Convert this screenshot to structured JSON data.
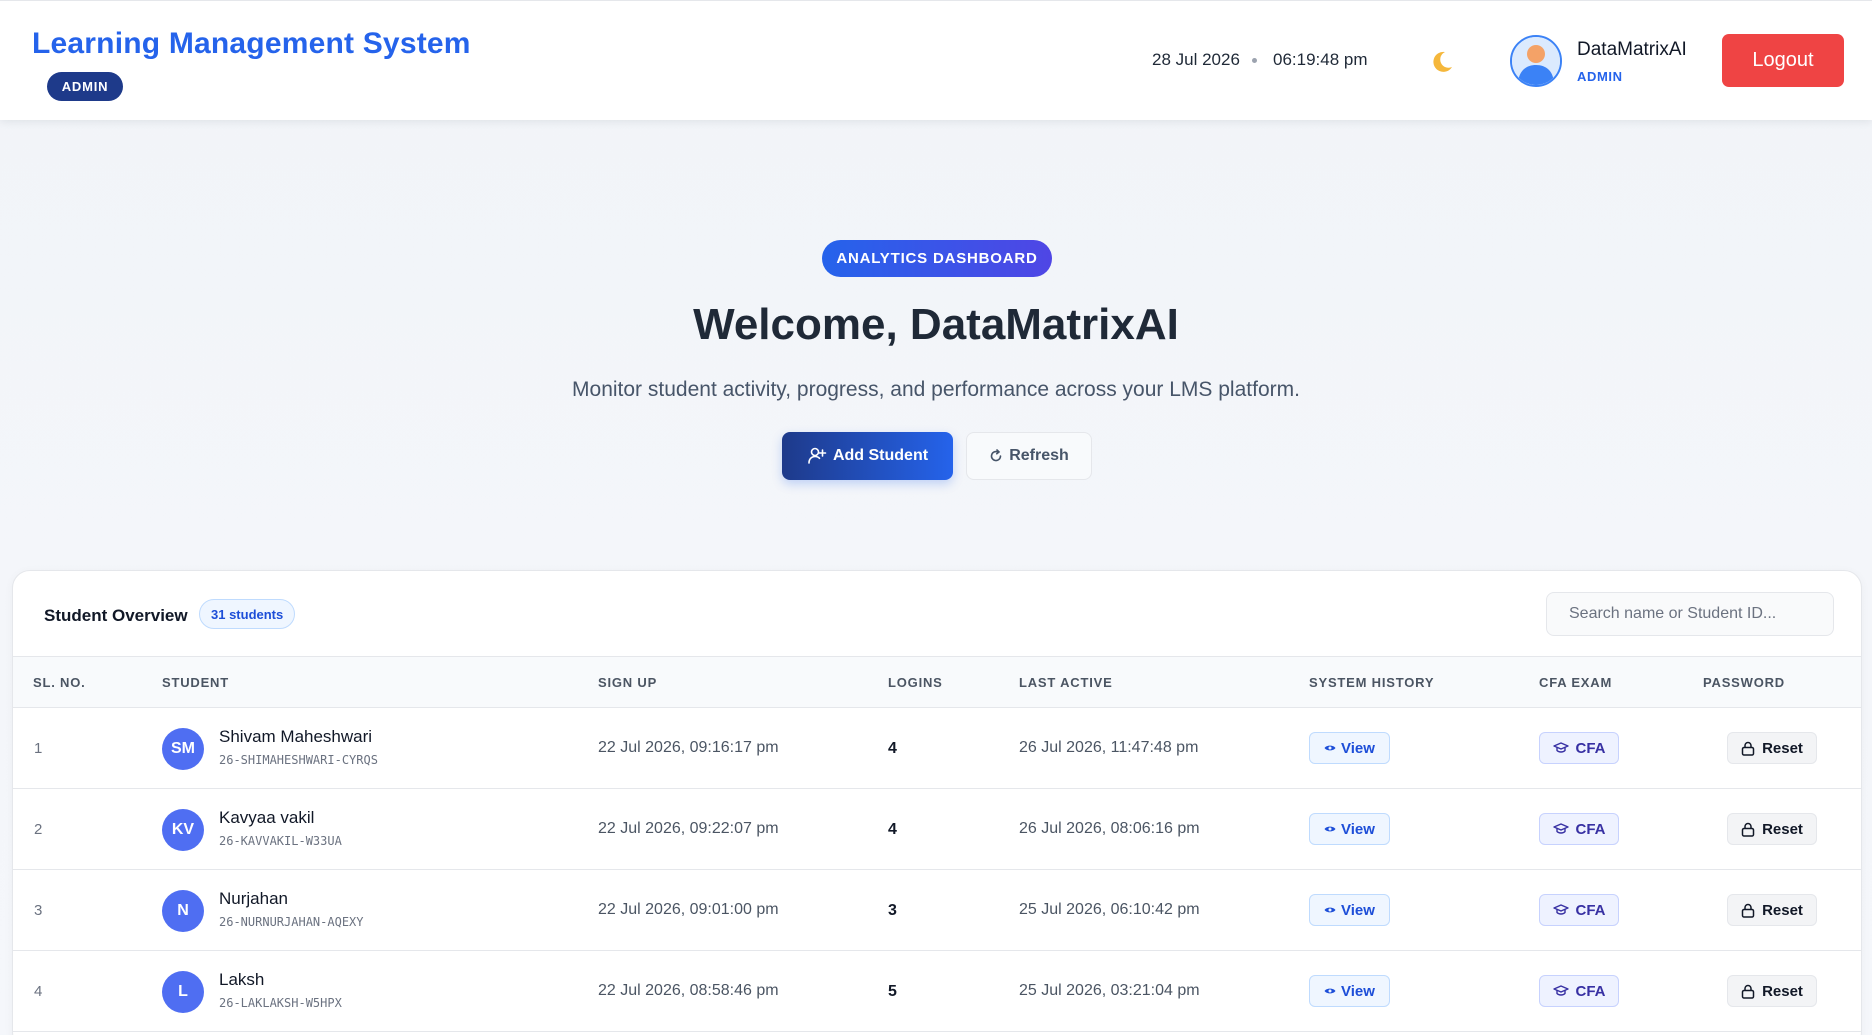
{
  "header": {
    "title": "Learning Management System",
    "role_badge": "ADMIN",
    "date": "28 Jul 2026",
    "time": "06:19:48 pm",
    "theme_icon": "moon-icon",
    "user_name": "DataMatrixAI",
    "user_role": "ADMIN",
    "logout_label": "Logout"
  },
  "hero": {
    "badge": "ANALYTICS DASHBOARD",
    "title": "Welcome, DataMatrixAI",
    "subtitle": "Monitor student activity, progress, and performance across your LMS platform.",
    "add_label": "Add Student",
    "refresh_label": "Refresh"
  },
  "overview": {
    "title": "Student Overview",
    "count_label": "31 students",
    "search_placeholder": "Search name or Student ID...",
    "columns": [
      "SL. NO.",
      "STUDENT",
      "SIGN UP",
      "LOGINS",
      "LAST ACTIVE",
      "SYSTEM HISTORY",
      "CFA EXAM",
      "PASSWORD"
    ],
    "rows": [
      {
        "sl": "1",
        "initials": "SM",
        "name": "Shivam Maheshwari",
        "student_id": "26-SHIMAHESHWARI-CYRQS",
        "signup": "22 Jul 2026, 09:16:17 pm",
        "logins": "4",
        "last_active": "26 Jul 2026, 11:47:48 pm",
        "view_label": "View",
        "cfa_label": "CFA",
        "reset_label": "Reset"
      },
      {
        "sl": "2",
        "initials": "KV",
        "name": "Kavyaa vakil",
        "student_id": "26-KAVVAKIL-W33UA",
        "signup": "22 Jul 2026, 09:22:07 pm",
        "logins": "4",
        "last_active": "26 Jul 2026, 08:06:16 pm",
        "view_label": "View",
        "cfa_label": "CFA",
        "reset_label": "Reset"
      },
      {
        "sl": "3",
        "initials": "N",
        "name": "Nurjahan",
        "student_id": "26-NURNURJAHAN-AQEXY",
        "signup": "22 Jul 2026, 09:01:00 pm",
        "logins": "3",
        "last_active": "25 Jul 2026, 06:10:42 pm",
        "view_label": "View",
        "cfa_label": "CFA",
        "reset_label": "Reset"
      },
      {
        "sl": "4",
        "initials": "L",
        "name": "Laksh",
        "student_id": "26-LAKLAKSH-W5HPX",
        "signup": "22 Jul 2026, 08:58:46 pm",
        "logins": "5",
        "last_active": "25 Jul 2026, 03:21:04 pm",
        "view_label": "View",
        "cfa_label": "CFA",
        "reset_label": "Reset"
      }
    ]
  },
  "colors": {
    "brand": "#2563eb",
    "logout": "#ef4444",
    "avatar": "#4f6ef2"
  }
}
